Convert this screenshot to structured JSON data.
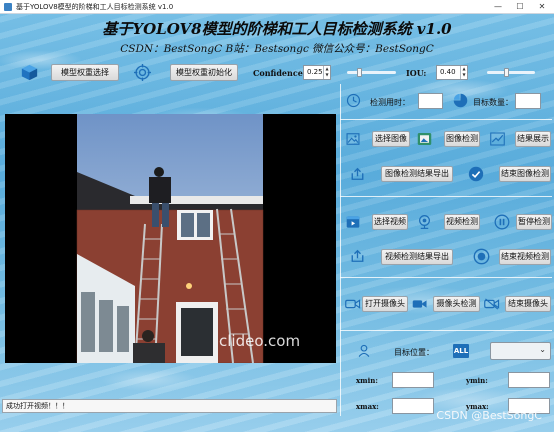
{
  "window": {
    "title": "基于YOLOV8模型的阶梯和工人目标检测系统 v1.0",
    "controls": [
      "—",
      "☐",
      "✕"
    ]
  },
  "header": {
    "title": "基于YOLOV8模型的阶梯和工人目标检测系统 v1.0",
    "subtitle": "CSDN：BestSongC   B站：Bestsongc   微信公众号：BestSongC"
  },
  "toolbar": {
    "model_select_label": "模型权重选择",
    "model_init_label": "模型权重初始化",
    "confidence_label": "Confidence:",
    "confidence_value": "0.25",
    "confidence_level": 0.25,
    "iou_label": "IOU:",
    "iou_value": "0.40",
    "iou_level": 0.4
  },
  "video": {
    "watermark": "clideo.com"
  },
  "panel": {
    "detect_time_label": "检测用时：",
    "detect_time_value": "",
    "target_count_label": "目标数量：",
    "target_count_value": "",
    "select_image_label": "选择图像",
    "image_detect_label": "图像检测",
    "result_show_label": "结果展示",
    "export_image_result_label": "图像检测结果导出",
    "end_image_detect_label": "结束图像检测",
    "select_video_label": "选择视频",
    "video_detect_label": "视频检测",
    "pause_detect_label": "暂停检测",
    "export_video_result_label": "视频检测结果导出",
    "end_video_detect_label": "结束视频检测",
    "open_camera_label": "打开摄像头",
    "camera_detect_label": "摄像头检测",
    "close_camera_label": "结束摄像头",
    "target_position_label": "目标位置：",
    "all_badge": "ALL",
    "target_select_value": "",
    "xmin_label": "xmin:",
    "xmin_value": "",
    "ymin_label": "ymin:",
    "ymin_value": "",
    "xmax_label": "xmax:",
    "xmax_value": "",
    "ymax_label": "ymax:",
    "ymax_value": ""
  },
  "status": {
    "message": "成功打开视频！！！"
  },
  "footer": {
    "watermark": "CSDN @BestSongC"
  },
  "colors": {
    "accent_blue": "#1e6fb8",
    "background": "#6bb8e2",
    "button_face": "#e4e4e4"
  }
}
